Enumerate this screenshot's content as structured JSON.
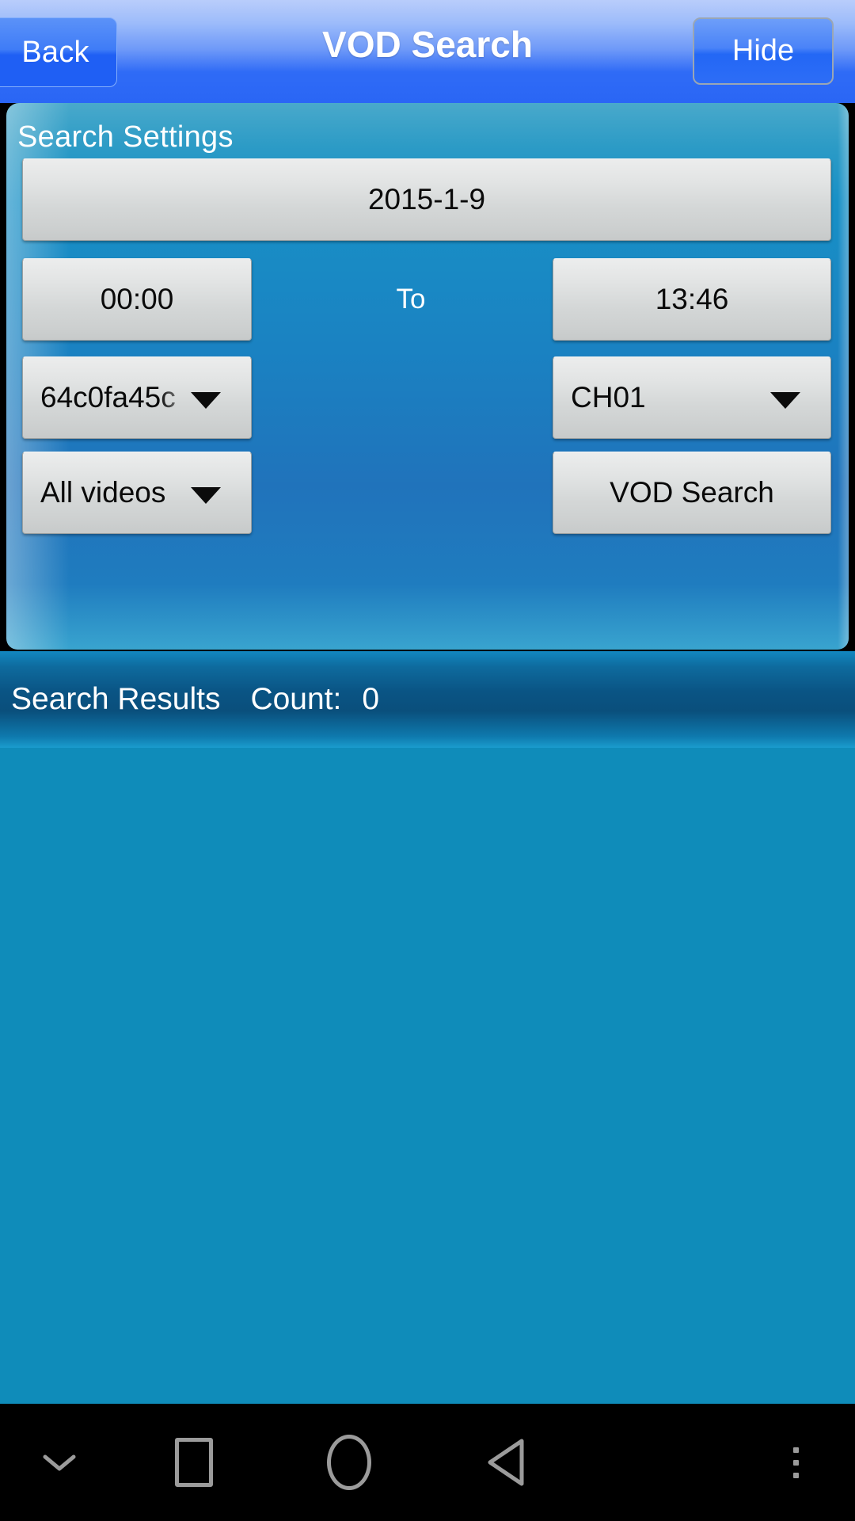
{
  "titlebar": {
    "back_label": "Back",
    "title": "VOD Search",
    "hide_label": "Hide"
  },
  "settings": {
    "panel_title": "Search Settings",
    "date_value": "2015-1-9",
    "time_start": "00:00",
    "to_label": "To",
    "time_end": "13:46",
    "device_value": "64c0fa45c",
    "channel_value": "CH01",
    "video_type_value": "All videos",
    "search_button_label": "VOD Search"
  },
  "results": {
    "title": "Search Results",
    "count_label": "Count:",
    "count_value": "0"
  },
  "navbar": {
    "hide_keyboard": "chevron-down-icon",
    "recents": "square-icon",
    "home": "circle-icon",
    "back": "triangle-left-icon",
    "menu": "three-dots-icon"
  },
  "colors": {
    "titlebar_blue": "#2a66f5",
    "panel_teal": "#1a82c2",
    "results_bar_dark": "#0a4f7c",
    "results_area": "#0f8cba",
    "button_grey": "#d4d7d7",
    "navbar_black": "#000000"
  }
}
